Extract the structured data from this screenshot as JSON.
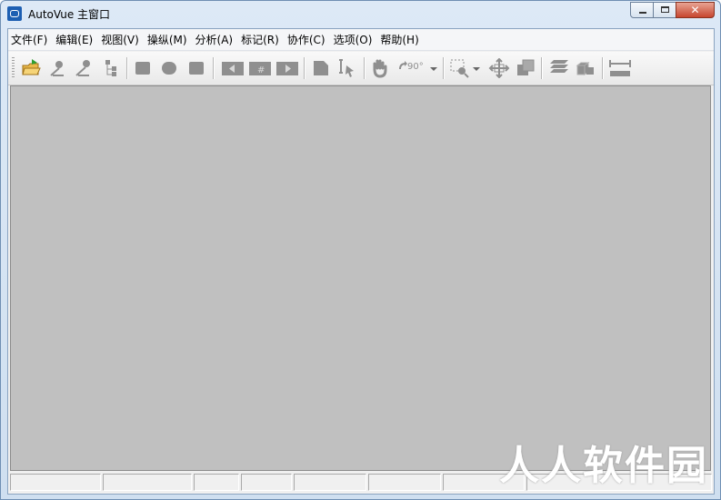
{
  "window": {
    "title": "AutoVue 主窗口"
  },
  "menu": {
    "items": [
      "文件(F)",
      "编辑(E)",
      "视图(V)",
      "操纵(M)",
      "分析(A)",
      "标记(R)",
      "协作(C)",
      "选项(O)",
      "帮助(H)"
    ]
  },
  "toolbar": {
    "rotate_label": "90°",
    "icons": [
      "open-folder-icon",
      "zoom-icon",
      "zoom-icon",
      "tree-icon",
      "print-icon",
      "print-icon",
      "export-icon",
      "first-page-icon",
      "page-number-icon",
      "next-page-icon",
      "region-icon",
      "select-text-icon",
      "pan-hand-icon",
      "rotate-icon",
      "zoom-box-icon",
      "fit-icon",
      "overlay-icon",
      "layers-icon",
      "3d-icon",
      "measure-icon"
    ]
  },
  "watermark": "人人软件园",
  "colors": {
    "canvas": "#c0c0c0",
    "titlebar": "#dde9f6",
    "close": "#c7462f"
  }
}
